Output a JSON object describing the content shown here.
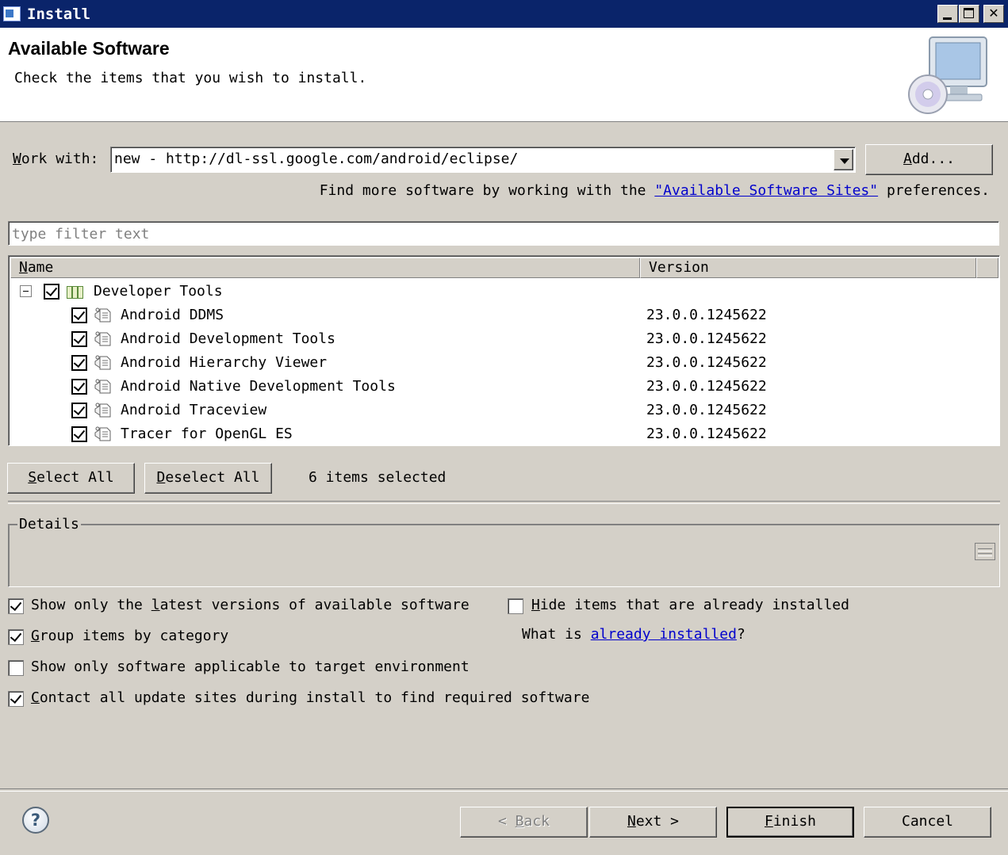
{
  "window": {
    "title": "Install"
  },
  "header": {
    "title": "Available Software",
    "subtitle": "Check the items that you wish to install."
  },
  "work_with": {
    "label_accel": "W",
    "label_rest": "ork with:",
    "value": "new - http://dl-ssl.google.com/android/eclipse/",
    "add_accel": "A",
    "add_rest": "dd...",
    "hint_prefix": "Find more software by working with the ",
    "hint_link": "\"Available Software Sites\"",
    "hint_suffix": " preferences."
  },
  "filter": {
    "placeholder": "type filter text"
  },
  "table": {
    "columns": {
      "name_accel": "N",
      "name_rest": "ame",
      "version": "Version"
    },
    "category": {
      "name": "Developer Tools",
      "checked": true
    },
    "rows": [
      {
        "name": "Android DDMS",
        "version": "23.0.0.1245622"
      },
      {
        "name": "Android Development Tools",
        "version": "23.0.0.1245622"
      },
      {
        "name": "Android Hierarchy Viewer",
        "version": "23.0.0.1245622"
      },
      {
        "name": "Android Native Development Tools",
        "version": "23.0.0.1245622"
      },
      {
        "name": "Android Traceview",
        "version": "23.0.0.1245622"
      },
      {
        "name": "Tracer for OpenGL ES",
        "version": "23.0.0.1245622"
      }
    ]
  },
  "selection": {
    "select_all_accel": "S",
    "select_all_rest": "elect All",
    "deselect_all_accel": "D",
    "deselect_all_rest": "eselect All",
    "status": "6 items selected"
  },
  "details": {
    "label": "Details"
  },
  "options": {
    "latest_a": "Show only the ",
    "latest_accel": "l",
    "latest_b": "atest versions of available software",
    "group_accel": "G",
    "group_rest": "roup items by category",
    "target": "Show only software applicable to target environment",
    "contact_accel": "C",
    "contact_rest": "ontact all update sites during install to find required software",
    "hide_accel": "H",
    "hide_rest": "ide items that are already installed",
    "whatis_prefix": "What is ",
    "whatis_link": "already installed",
    "whatis_suffix": "?"
  },
  "footer": {
    "back_accel": "B",
    "back_rest": "ack",
    "next_accel": "N",
    "next_rest": "ext",
    "finish_accel": "F",
    "finish_rest": "inish",
    "cancel": "Cancel",
    "back_prefix": "< ",
    "next_suffix": " >"
  }
}
